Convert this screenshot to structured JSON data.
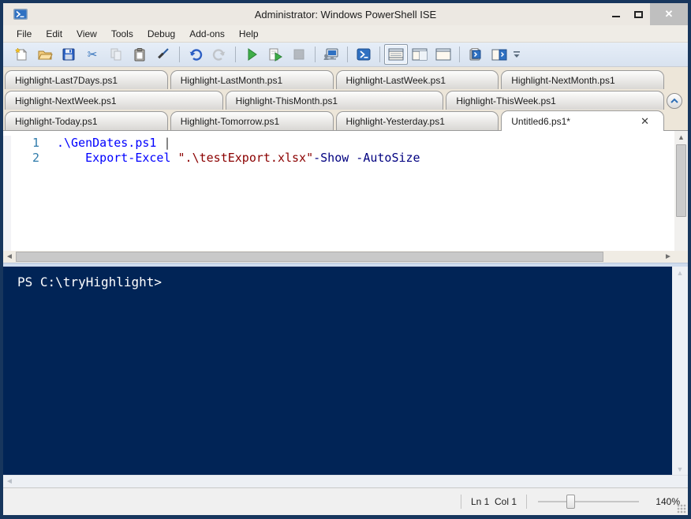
{
  "window": {
    "title": "Administrator: Windows PowerShell ISE"
  },
  "titlebar": {
    "buttons": [
      {
        "name": "minimize-button",
        "icon": "minimize-icon"
      },
      {
        "name": "maximize-button",
        "icon": "maximize-icon"
      },
      {
        "name": "close-button",
        "icon": "close-icon",
        "glyph": "✕"
      }
    ]
  },
  "menu": {
    "items": [
      "File",
      "Edit",
      "View",
      "Tools",
      "Debug",
      "Add-ons",
      "Help"
    ]
  },
  "toolbar": {
    "items": [
      {
        "name": "new-script",
        "icon": "new-script-icon"
      },
      {
        "name": "open-script",
        "icon": "open-folder-icon"
      },
      {
        "name": "save-script",
        "icon": "save-icon"
      },
      {
        "name": "cut",
        "icon": "cut-icon"
      },
      {
        "name": "copy",
        "icon": "copy-icon",
        "disabled": true
      },
      {
        "name": "paste",
        "icon": "paste-icon"
      },
      {
        "name": "clear-console-pane",
        "icon": "clear-pane-icon"
      },
      {
        "sep": true
      },
      {
        "name": "undo",
        "icon": "undo-icon"
      },
      {
        "name": "redo",
        "icon": "redo-icon",
        "disabled": true
      },
      {
        "sep": true
      },
      {
        "name": "run-script",
        "icon": "run-icon"
      },
      {
        "name": "run-selection",
        "icon": "run-selection-icon"
      },
      {
        "name": "stop-operation",
        "icon": "stop-icon",
        "disabled": true
      },
      {
        "sep": true
      },
      {
        "name": "new-remote-powershell-tab",
        "icon": "remote-tab-icon"
      },
      {
        "sep": true
      },
      {
        "name": "start-powershell-exe",
        "icon": "powershell-icon"
      },
      {
        "sep": true
      },
      {
        "name": "show-script-pane-top",
        "icon": "layout-top-icon",
        "selected": true
      },
      {
        "name": "show-script-pane-right",
        "icon": "layout-right-icon"
      },
      {
        "name": "show-script-pane-maximized",
        "icon": "layout-max-icon"
      },
      {
        "sep": true
      },
      {
        "name": "new-powershell-tab",
        "icon": "new-tab-icon"
      },
      {
        "name": "show-script-pane",
        "icon": "script-pane-icon"
      }
    ]
  },
  "tabs": {
    "rows": [
      [
        {
          "label": "Highlight-Last7Days.ps1"
        },
        {
          "label": "Highlight-LastMonth.ps1"
        },
        {
          "label": "Highlight-LastWeek.ps1"
        },
        {
          "label": "Highlight-NextMonth.ps1"
        }
      ],
      [
        {
          "label": "Highlight-NextWeek.ps1"
        },
        {
          "label": "Highlight-ThisMonth.ps1"
        },
        {
          "label": "Highlight-ThisWeek.ps1"
        }
      ],
      [
        {
          "label": "Highlight-Today.ps1"
        },
        {
          "label": "Highlight-Tomorrow.ps1"
        },
        {
          "label": "Highlight-Yesterday.ps1"
        },
        {
          "label": "Untitled6.ps1*",
          "active": true,
          "close_glyph": "✕"
        }
      ]
    ]
  },
  "editor": {
    "lines": [
      {
        "num": "1",
        "segments": [
          {
            "text": ".\\GenDates.ps1 ",
            "color": "#0000ff"
          },
          {
            "text": "|",
            "color": "#414141"
          }
        ]
      },
      {
        "num": "2",
        "segments": [
          {
            "text": "    ",
            "color": "#000000"
          },
          {
            "text": "Export-Excel",
            "color": "#0000ff"
          },
          {
            "text": " ",
            "color": "#000000"
          },
          {
            "text": "\".\\testExport.xlsx\"",
            "color": "#8b0000"
          },
          {
            "text": "-Show -AutoSize",
            "color": "#000080"
          }
        ]
      }
    ]
  },
  "console": {
    "prompt": "PS C:\\tryHighlight>"
  },
  "statusbar": {
    "position": "Ln 1  Col 1",
    "zoom_percent": "140%"
  },
  "colors": {
    "console_bg": "#012456",
    "window_border": "#17365d",
    "command": "#0000ff",
    "string": "#8b0000",
    "parameter": "#000080",
    "line_number": "#2f7bab"
  }
}
